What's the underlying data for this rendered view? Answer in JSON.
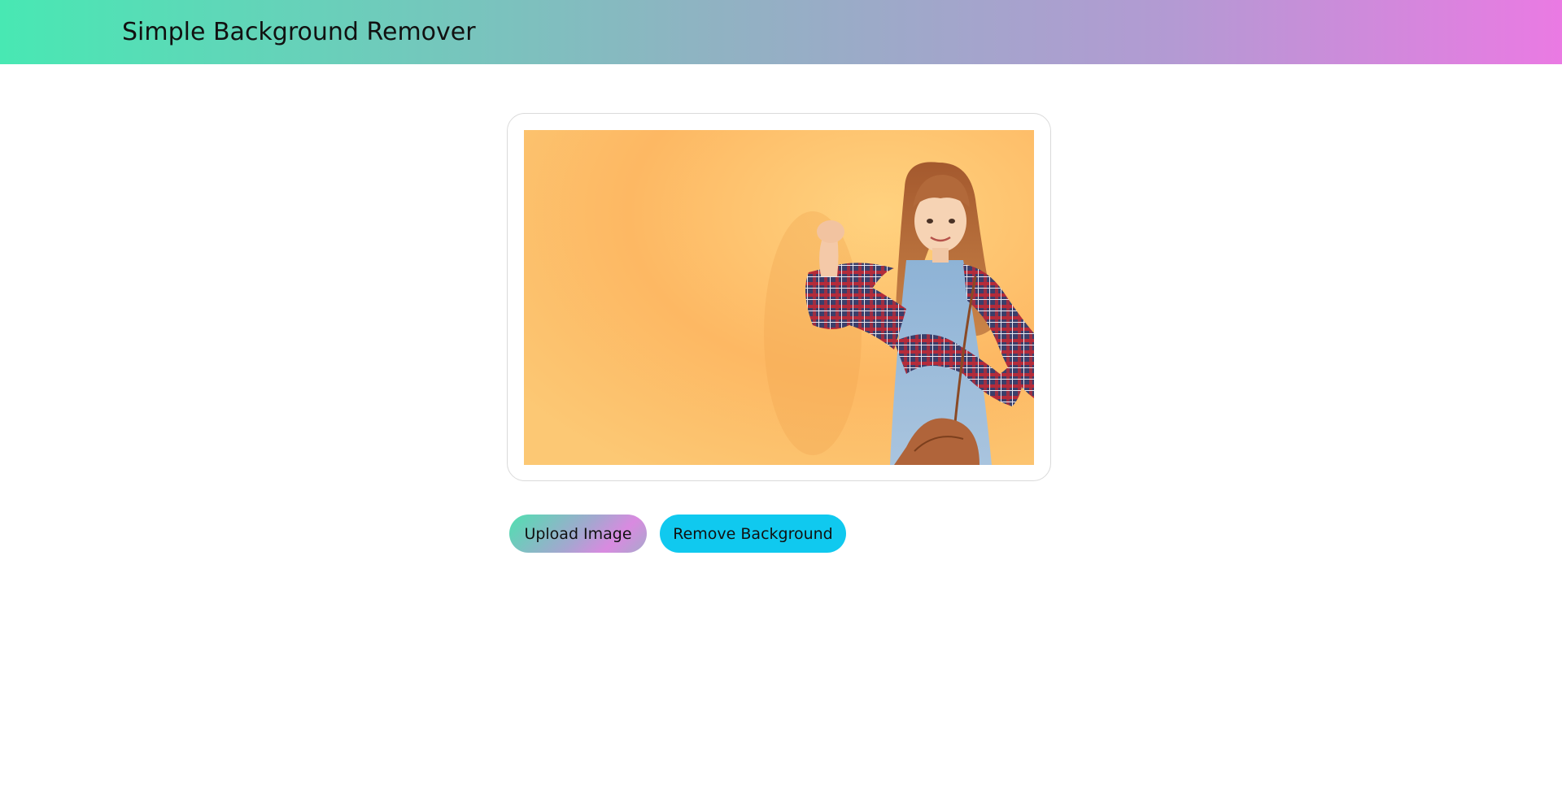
{
  "header": {
    "title": "Simple Background Remover"
  },
  "preview": {
    "image_icon": "photo-of-girl-on-orange-background"
  },
  "actions": {
    "upload_label": "Upload Image",
    "remove_label": "Remove Background"
  },
  "colors": {
    "header_gradient_start": "#48e8b3",
    "header_gradient_end": "#ea7ae3",
    "remove_button": "#10c9ef",
    "photo_background": "#fdb863"
  }
}
